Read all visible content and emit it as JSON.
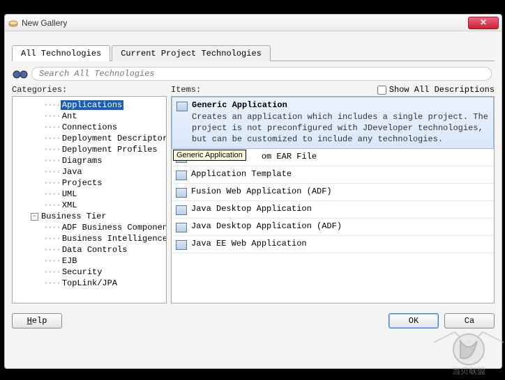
{
  "window": {
    "title": "New Gallery"
  },
  "tabs": {
    "all": "All Technologies",
    "current": "Current Project Technologies"
  },
  "search": {
    "placeholder": "Search All Technologies"
  },
  "categories": {
    "label": "Categories:",
    "nodes": [
      "Applications",
      "Ant",
      "Connections",
      "Deployment Descriptors",
      "Deployment Profiles",
      "Diagrams",
      "Java",
      "Projects",
      "UML",
      "XML"
    ],
    "business_tier_label": "Business Tier",
    "business_tier": [
      "ADF Business Components",
      "Business Intelligence",
      "Data Controls",
      "EJB",
      "Security",
      "TopLink/JPA"
    ]
  },
  "items": {
    "label": "Items:",
    "show_all_label": "Show All Descriptions",
    "tooltip": "Generic Application",
    "selected": {
      "title": "Generic Application",
      "desc": "Creates an application which includes a single project. The project is not preconfigured with JDeveloper technologies, but can be customized to include any technologies."
    },
    "list": [
      "om EAR File",
      "Application Template",
      "Fusion Web Application (ADF)",
      "Java Desktop Application",
      "Java Desktop Application (ADF)",
      "Java EE Web Application"
    ]
  },
  "buttons": {
    "help": "Help",
    "ok": "OK",
    "cancel": "Ca"
  }
}
